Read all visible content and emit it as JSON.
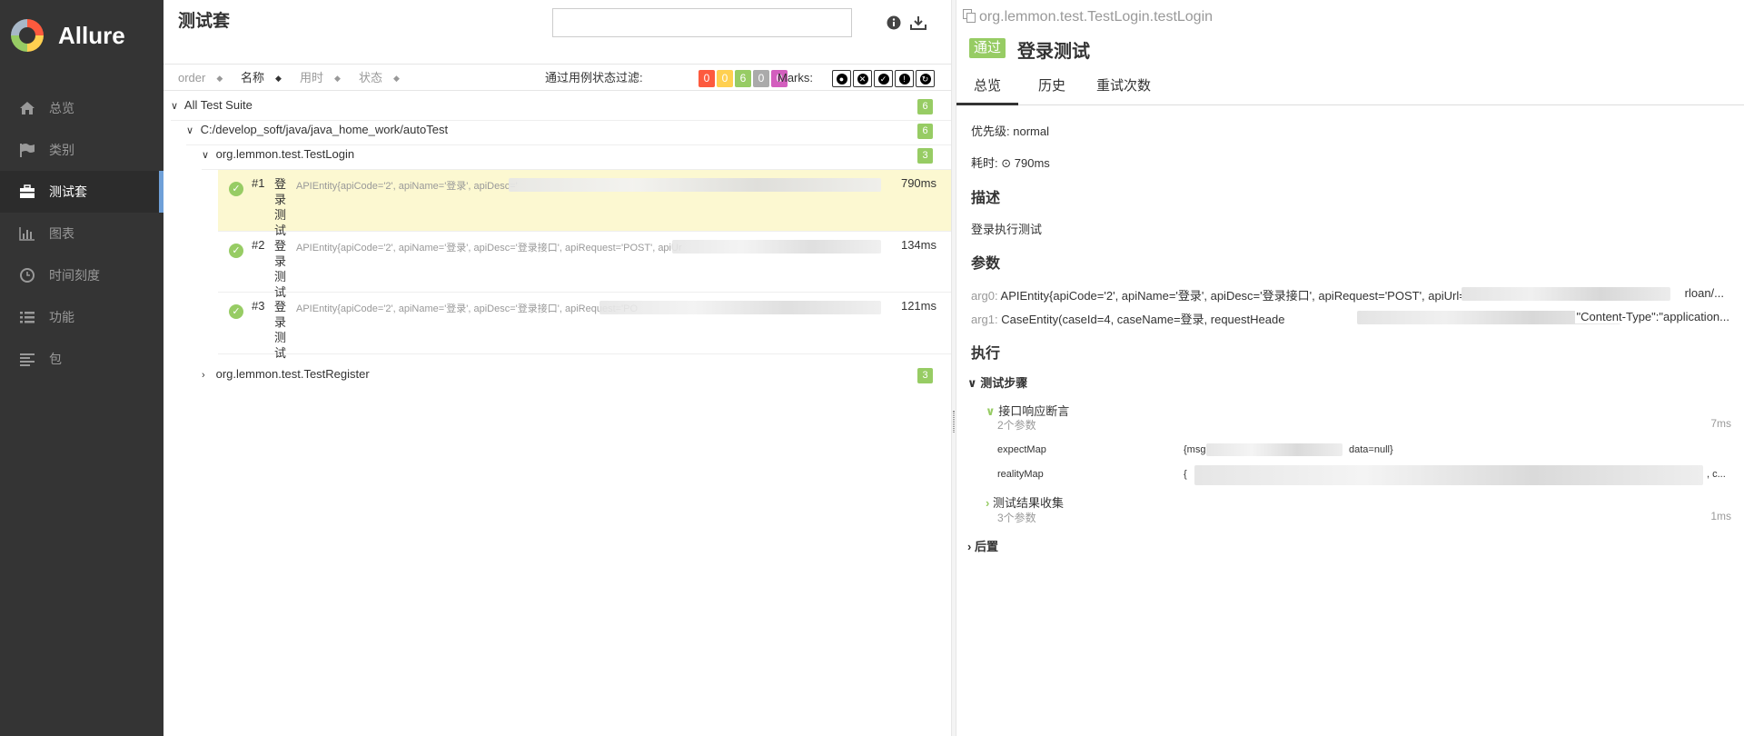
{
  "app": {
    "brand": "Allure"
  },
  "sidebar": {
    "items": [
      {
        "label": "总览",
        "icon": "home-icon",
        "active": false
      },
      {
        "label": "类别",
        "icon": "flag-icon",
        "active": false
      },
      {
        "label": "测试套",
        "icon": "briefcase-icon",
        "active": true
      },
      {
        "label": "图表",
        "icon": "bar-chart-icon",
        "active": false
      },
      {
        "label": "时间刻度",
        "icon": "clock-icon",
        "active": false
      },
      {
        "label": "功能",
        "icon": "list-icon",
        "active": false
      },
      {
        "label": "包",
        "icon": "align-left-icon",
        "active": false
      }
    ]
  },
  "tree": {
    "title": "测试套",
    "search_value": "",
    "sort": {
      "order": "order",
      "name": "名称",
      "duration": "用时",
      "status": "状态"
    },
    "filter_label": "通过用例状态过滤:",
    "filters": [
      {
        "value": "0",
        "color": "#fd5a3e"
      },
      {
        "value": "0",
        "color": "#ffd050"
      },
      {
        "value": "6",
        "color": "#97cc64"
      },
      {
        "value": "0",
        "color": "#aaaaaa"
      },
      {
        "value": "0",
        "color": "#d35ebe"
      }
    ],
    "marks_label": "Marks:",
    "nodes": {
      "root": {
        "label": "All Test Suite",
        "count": "6"
      },
      "path": {
        "label": "C:/develop_soft/java/java_home_work/autoTest",
        "count": "6"
      },
      "login": {
        "label": "org.lemmon.test.TestLogin",
        "count": "3"
      },
      "register": {
        "label": "org.lemmon.test.TestRegister",
        "count": "3"
      }
    },
    "cases": [
      {
        "num": "#1",
        "name": "登录测试",
        "params": "APIEntity{apiCode='2', apiName='登录', apiDesc='",
        "duration": "790ms"
      },
      {
        "num": "#2",
        "name": "登录测试",
        "params": "APIEntity{apiCode='2', apiName='登录', apiDesc='登录接口', apiRequest='POST', apiUr",
        "duration": "134ms"
      },
      {
        "num": "#3",
        "name": "登录测试",
        "params": "APIEntity{apiCode='2', apiName='登录', apiDesc='登录接口', apiRequest='PO",
        "duration": "121ms"
      }
    ]
  },
  "detail": {
    "fullname": "org.lemmon.test.TestLogin.testLogin",
    "status": "通过",
    "title": "登录测试",
    "tabs": [
      "总览",
      "历史",
      "重试次数"
    ],
    "severity_label": "优先级:",
    "severity": "normal",
    "duration_label": "耗时:",
    "duration": "790ms",
    "description_h": "描述",
    "description": "登录执行测试",
    "params_h": "参数",
    "params": [
      {
        "name": "arg0:",
        "value_start": "APIEntity{apiCode='2', apiName='登录', apiDesc='登录接口', apiRequest='POST', apiUrl=",
        "value_end": "rloan/..."
      },
      {
        "name": "arg1:",
        "value_start": "CaseEntity(caseId=4, caseName=登录, requestHeade",
        "value_end": "\"Content-Type\":\"application..."
      }
    ],
    "execution_h": "执行",
    "steps_group": "测试步骤",
    "steps": [
      {
        "name": "接口响应断言",
        "sub": "2个参数",
        "duration": "7ms"
      },
      {
        "name": "测试结果收集",
        "sub": "3个参数",
        "duration": "1ms"
      }
    ],
    "step_params": [
      {
        "name": "expectMap",
        "value_start": "{msg=",
        "value_end": "data=null}"
      },
      {
        "name": "realityMap",
        "value_start": "{",
        "value_end": ", c..."
      }
    ],
    "teardown": "后置"
  }
}
